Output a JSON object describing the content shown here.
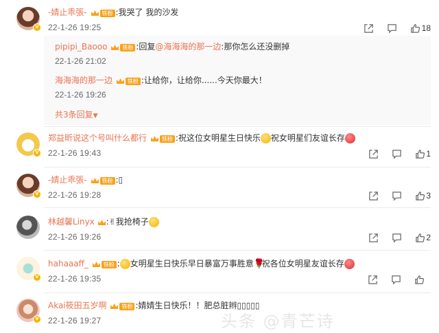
{
  "comments": [
    {
      "username": "-婧止乖張-",
      "badge": "铁粉",
      "text": ":我哭了 我的沙发",
      "time": "22-1-26 19:25",
      "likes": "18",
      "replies": [
        {
          "username": "pipipi_Baooo",
          "badge": "铁粉",
          "prefix": ":回复",
          "mention": "@海海海的那一边",
          "text": ":那你怎么还没删掉",
          "time": "22-1-26 21:02"
        },
        {
          "username": "海海海的那一边",
          "badge": "铁粉",
          "text": ":让给你，让给你......今天你最大！",
          "time": "22-1-26 19:26"
        }
      ],
      "more_replies": "共3条回复"
    },
    {
      "username": "郑益昕说这个号叫什么都行",
      "badge": "铁粉",
      "text_a": ":祝这位女明星生日快乐",
      "text_b": "祝女明星们友谊长存",
      "time": "22-1-26 19:43",
      "likes": "1"
    },
    {
      "username": "-婧止乖張-",
      "badge": "铁粉",
      "text": ":▯",
      "time": "22-1-26 19:28",
      "likes": "3"
    },
    {
      "username": "林越馨Linyx",
      "text": ":✌我抢椅子",
      "time": "22-1-26 19:26",
      "likes": "2"
    },
    {
      "username": "hahaaaff_",
      "badge": "铁粉",
      "text_a": ":",
      "text_b": "女明星生日快乐早日暴富万事胜意",
      "text_c": "祝各位女明星友谊长存",
      "time": "22-1-26 19:35"
    },
    {
      "username": "Akai筱田五岁啊",
      "badge": "铁粉",
      "text": ":婧婧生日快乐！！肥总脏辫▯▯▯▯▯",
      "time": "22-1-26 19:27"
    }
  ],
  "watermark": "头条 @青芒诗",
  "colors": {
    "accent": "#eb7350",
    "badge": "#f7a21b",
    "vip": "#f7b500"
  },
  "icons": {
    "share": "share-icon",
    "comment": "comment-icon",
    "like": "thumbs-up-icon"
  }
}
